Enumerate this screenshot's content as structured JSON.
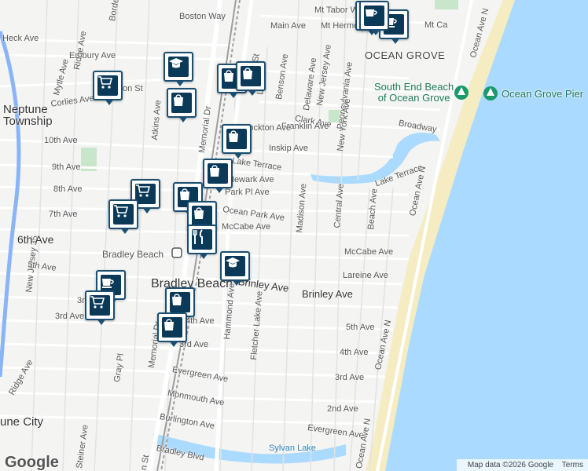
{
  "map": {
    "labels": {
      "heck_ave": "Heck Ave",
      "boston_way": "Boston Way",
      "borden_ave": "Borden Ave",
      "main_ave": "Main Ave",
      "mt_tabor_way": "Mt Tabor Way",
      "mt_hermon_way": "Mt Hermon Way",
      "mt_ca": "Mt Ca",
      "embury_ave": "Embury Ave",
      "ridge_ave_top": "Ridge Ave",
      "mytle_ave": "Mytle Ave",
      "corlies_ave": "Corlies Ave",
      "nston_st": "on St",
      "neptune_township": "Neptune\nTownship",
      "atkins_ave": "Atkins Ave",
      "memorial_dr_top": "Memorial Dr",
      "st_top": "St",
      "benson_ave": "Benson Ave",
      "la_ave": "La",
      "delaware_ave": "Delaware Ave",
      "new_jersey_ave": "New Jersey Ave",
      "pennsylvania_ave": "Pennsylvania Ave",
      "ocean_grove": "OCEAN GROVE",
      "new_york_ave": "New York Ave",
      "south_end_beach": "South End Beach\nof Ocean Grove",
      "ocean_grove_pier": "Ocean Grove Pier",
      "ocean_ave_n_top": "Ocean Ave N",
      "clark_ave": "Clark Ave",
      "franklin_ave": "Franklin Ave",
      "stockton_ave": "Stockton Ave",
      "broadway": "Broadway",
      "tenth_ave": "10th Ave",
      "inskip_ave": "Inskip Ave",
      "ninth_ave": "9th Ave",
      "lake_terrace_w": "Lake Terrace",
      "lake_terrace_e": "Lake Terrace",
      "newark_ave": "Newark Ave",
      "eighth_ave": "8th Ave",
      "park_pl_ave": "Park Pl Ave",
      "madison_ave": "Madison Ave",
      "central_ave": "Central Ave",
      "beach_ave": "Beach Ave",
      "ocean_ave_n_mid": "Ocean Ave N",
      "seventh_ave": "7th Ave",
      "ocean_park_ave": "Ocean Park Ave",
      "new_jersey_35": "New Jersey 35",
      "sixth_ave": "6th Ave",
      "mccabe_ave_w": "McCabe Ave",
      "mccabe_ave_e": "McCabe Ave",
      "bradley_beach_station": "Bradley Beach",
      "fifth_ave_w": "5th Ave",
      "lareine_ave": "Lareine Ave",
      "bradley_beach": "Bradley Beach",
      "brinley_ave_w": "Brinley Ave",
      "brinley_ave_e": "Brinley Ave",
      "hammond_ave": "Hammond Ave",
      "fletcher_lake_ave": "Fletcher Lake Ave",
      "fourth_ave_w": "4th Ave",
      "fifth_ave_e": "5th Ave",
      "memorial_dr_bottom": "Memorial Dr",
      "third_ave_w": "3rd Ave",
      "third_ave_mid": "3rd Ave",
      "fourth_ave_e": "4th Ave",
      "ocean_ave_n_low": "Ocean Ave N",
      "evergreen_ave_w": "Evergreen Ave",
      "third_ave_e": "3rd Ave",
      "ridge_ave_bottom": "Ridge Ave",
      "gray_pl": "Gray Pl",
      "monmouth_ave": "Monmouth Ave",
      "second_ave": "2nd Ave",
      "une_city": "une City",
      "steiner_ave": "Steiner Ave",
      "burlington_ave": "Burlington Ave",
      "evergreen_ave_e": "Evergreen Ave",
      "bradley_blvd": "Bradley Blvd",
      "sylvan_lake": "Sylvan Lake",
      "ocean_ave_n_bottom": "Ocean Ave N",
      "st_bottom": "n St",
      "third_ave_wl": "3rd Ave"
    },
    "pins": [
      {
        "icon": "shopping-bag-icon"
      },
      {
        "icon": "coffee-cup-icon"
      },
      {
        "icon": "coffee-cup-icon"
      },
      {
        "icon": "graduation-cap-icon"
      },
      {
        "icon": "shopping-cart-icon"
      },
      {
        "icon": "shopping-bag-icon"
      },
      {
        "icon": "shopping-bag-icon"
      },
      {
        "icon": "shopping-bag-icon"
      },
      {
        "icon": "shopping-bag-icon"
      },
      {
        "icon": "shopping-cart-icon"
      },
      {
        "icon": "shopping-cart-icon"
      },
      {
        "icon": "shopping-bag-icon"
      },
      {
        "icon": "shopping-bag-icon"
      },
      {
        "icon": "shopping-bag-icon"
      },
      {
        "icon": "fork-knife-icon"
      },
      {
        "icon": "graduation-cap-icon"
      },
      {
        "icon": "coffee-cup-icon"
      },
      {
        "icon": "shopping-cart-icon"
      },
      {
        "icon": "shopping-bag-icon"
      },
      {
        "icon": "shopping-bag-icon"
      }
    ],
    "logo": "Google",
    "attribution": {
      "map_data": "Map data ©2026 Google",
      "terms": "Terms"
    },
    "colors": {
      "water": "#aadaff",
      "land": "#f4f4f2",
      "park": "#c8e6c9",
      "beach": "#f5ecc2",
      "rail": "#9e9e9e",
      "highway": "#8ab4f8",
      "pin_fill": "#0b3a59",
      "pin_border": "#1b4f72"
    }
  }
}
